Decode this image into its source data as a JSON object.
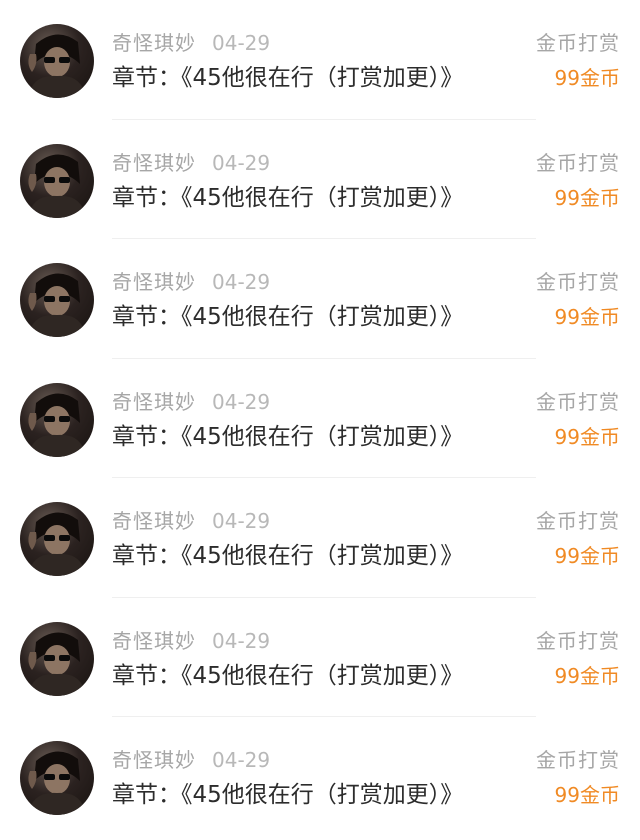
{
  "records": [
    {
      "user": "奇怪琪妙",
      "date": "04-29",
      "chapter": "章节：《45他很在行（打赏加更）》",
      "type": "金币打赏",
      "amount": "99金币",
      "avatar_icon": "user-avatar"
    },
    {
      "user": "奇怪琪妙",
      "date": "04-29",
      "chapter": "章节：《45他很在行（打赏加更）》",
      "type": "金币打赏",
      "amount": "99金币",
      "avatar_icon": "user-avatar"
    },
    {
      "user": "奇怪琪妙",
      "date": "04-29",
      "chapter": "章节：《45他很在行（打赏加更）》",
      "type": "金币打赏",
      "amount": "99金币",
      "avatar_icon": "user-avatar"
    },
    {
      "user": "奇怪琪妙",
      "date": "04-29",
      "chapter": "章节：《45他很在行（打赏加更）》",
      "type": "金币打赏",
      "amount": "99金币",
      "avatar_icon": "user-avatar"
    },
    {
      "user": "奇怪琪妙",
      "date": "04-29",
      "chapter": "章节：《45他很在行（打赏加更）》",
      "type": "金币打赏",
      "amount": "99金币",
      "avatar_icon": "user-avatar"
    },
    {
      "user": "奇怪琪妙",
      "date": "04-29",
      "chapter": "章节：《45他很在行（打赏加更）》",
      "type": "金币打赏",
      "amount": "99金币",
      "avatar_icon": "user-avatar"
    },
    {
      "user": "奇怪琪妙",
      "date": "04-29",
      "chapter": "章节：《45他很在行（打赏加更）》",
      "type": "金币打赏",
      "amount": "99金币",
      "avatar_icon": "user-avatar"
    }
  ],
  "colors": {
    "accent": "#f08a24",
    "muted_text": "#a6a6a6",
    "primary_text": "#2c2c2c",
    "divider": "#efefef"
  }
}
